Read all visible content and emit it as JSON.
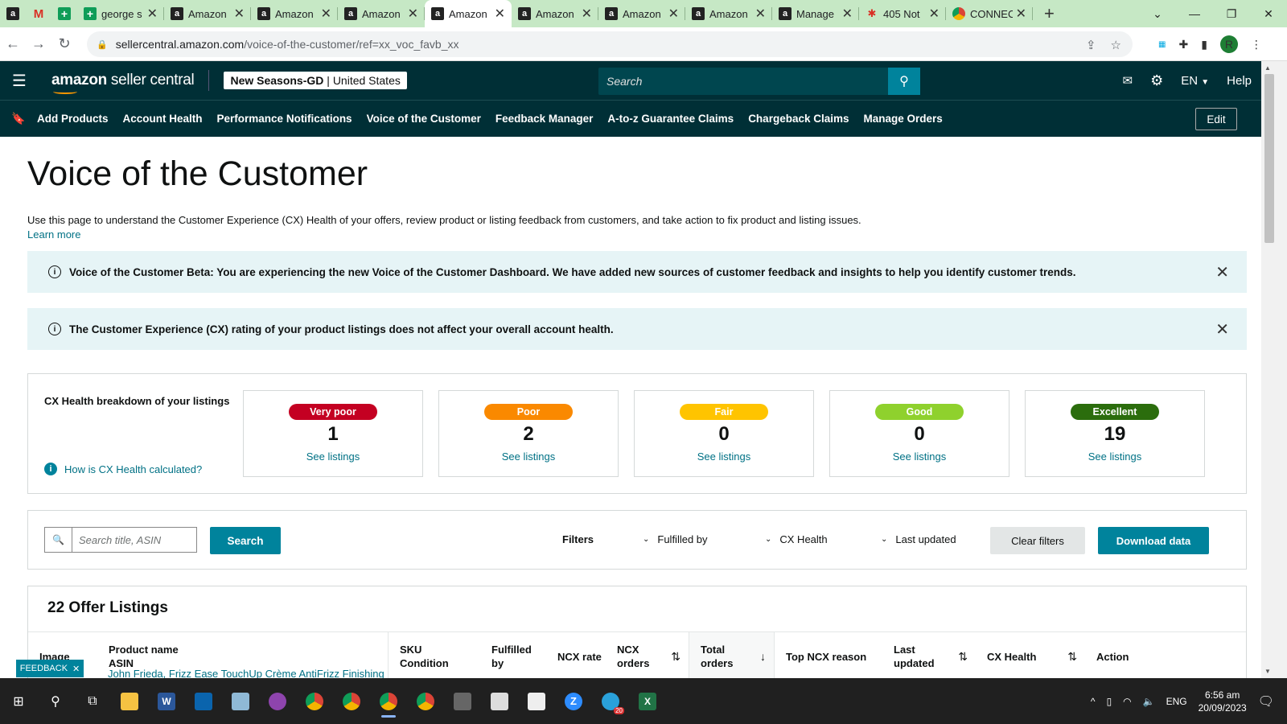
{
  "browser": {
    "tabs": [
      {
        "type": "pin",
        "icon": "amazon-icon"
      },
      {
        "type": "pin",
        "icon": "gmail-icon"
      },
      {
        "type": "pin",
        "icon": "sheets-icon"
      },
      {
        "type": "norm",
        "icon": "sheets-icon",
        "title": "george s"
      },
      {
        "type": "norm",
        "icon": "amazon-icon",
        "title": "Amazon"
      },
      {
        "type": "norm",
        "icon": "amazon-icon",
        "title": "Amazon"
      },
      {
        "type": "norm",
        "icon": "amazon-icon",
        "title": "Amazon"
      },
      {
        "type": "norm",
        "icon": "amazon-icon",
        "title": "Amazon",
        "active": true
      },
      {
        "type": "norm",
        "icon": "amazon-icon",
        "title": "Amazon"
      },
      {
        "type": "norm",
        "icon": "amazon-icon",
        "title": "Amazon"
      },
      {
        "type": "norm",
        "icon": "amazon-icon",
        "title": "Amazon"
      },
      {
        "type": "norm",
        "icon": "amazon-icon",
        "title": "Manage"
      },
      {
        "type": "norm",
        "icon": "slack-icon",
        "title": "405 Not"
      },
      {
        "type": "norm",
        "icon": "chrome-icon",
        "title": "CONNEC"
      }
    ],
    "url_host": "sellercentral.amazon.com",
    "url_path": "/voice-of-the-customer/ref=xx_voc_favb_xx",
    "profile_initial": "R"
  },
  "header": {
    "logo_bold": "amazon",
    "logo_light": " seller central",
    "store_name": "New Seasons-GD",
    "store_region": "United States",
    "search_placeholder": "Search",
    "language": "EN",
    "help": "Help"
  },
  "nav": {
    "links": [
      "Add Products",
      "Account Health",
      "Performance Notifications",
      "Voice of the Customer",
      "Feedback Manager",
      "A-to-z Guarantee Claims",
      "Chargeback Claims",
      "Manage Orders"
    ],
    "edit": "Edit"
  },
  "page": {
    "title": "Voice of the Customer",
    "description": "Use this page to understand the Customer Experience (CX) Health of your offers, review product or listing feedback from customers, and take action to fix product and listing issues.",
    "learn_more": "Learn more",
    "alert1": "Voice of the Customer Beta: You are experiencing the new Voice of the Customer Dashboard. We have added new sources of customer feedback and insights to help you identify customer trends.",
    "alert2": "The Customer Experience (CX) rating of your product listings does not affect your overall account health."
  },
  "cx": {
    "label": "CX Health breakdown of your listings",
    "how_link": "How is CX Health calculated?",
    "see_listings": "See listings",
    "cards": [
      {
        "label": "Very poor",
        "count": "1",
        "color": "#c40022"
      },
      {
        "label": "Poor",
        "count": "2",
        "color": "#fa8900"
      },
      {
        "label": "Fair",
        "count": "0",
        "color": "#ffc400"
      },
      {
        "label": "Good",
        "count": "0",
        "color": "#8fd12d"
      },
      {
        "label": "Excellent",
        "count": "19",
        "color": "#2b6d0d"
      }
    ]
  },
  "filters": {
    "search_placeholder": "Search title, ASIN",
    "search_button": "Search",
    "label": "Filters",
    "fulfilled_by": "Fulfilled by",
    "cx_health": "CX Health",
    "last_updated": "Last updated",
    "clear": "Clear filters",
    "download": "Download data"
  },
  "table": {
    "title": "22 Offer Listings",
    "columns": [
      {
        "l1": "Image",
        "l2": ""
      },
      {
        "l1": "Product name",
        "l2": "ASIN"
      },
      {
        "l1": "SKU",
        "l2": "Condition"
      },
      {
        "l1": "Fulfilled",
        "l2": "by"
      },
      {
        "l1": "NCX rate",
        "l2": ""
      },
      {
        "l1": "NCX",
        "l2": "orders"
      },
      {
        "l1": "Total",
        "l2": "orders"
      },
      {
        "l1": "Top NCX reason",
        "l2": ""
      },
      {
        "l1": "Last",
        "l2": "updated"
      },
      {
        "l1": "CX Health",
        "l2": ""
      },
      {
        "l1": "Action",
        "l2": ""
      }
    ],
    "first_row_product": "John Frieda, Frizz Ease TouchUp Crème AntiFrizz Finishing"
  },
  "feedback": "FEEDBACK",
  "taskbar": {
    "language": "ENG",
    "time": "6:56 am",
    "date": "20/09/2023",
    "badge": "20"
  }
}
